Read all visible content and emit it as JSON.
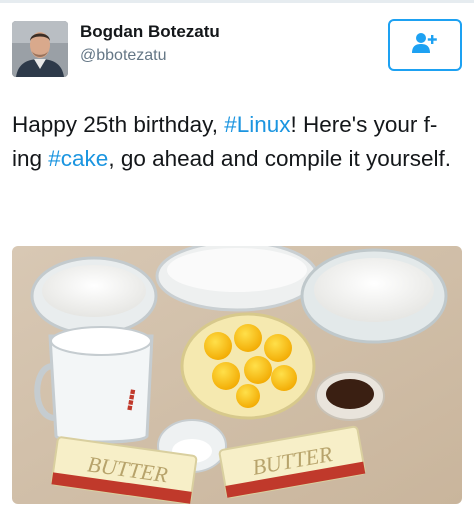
{
  "user": {
    "display_name": "Bogdan Botezatu",
    "handle": "@bbotezatu"
  },
  "follow_button": {
    "icon": "add-user-icon"
  },
  "tweet": {
    "text_1": "Happy 25th birthday, ",
    "hashtag_1": "#Linux",
    "text_2": "! Here's your f-ing ",
    "hashtag_2": "#cake",
    "text_3": ", go ahead and compile it yourself."
  },
  "photo": {
    "butter_label_left": "BUTTER",
    "butter_label_right": "BUTTER"
  },
  "colors": {
    "accent": "#1da1f2",
    "hashtag": "#1b95e0",
    "handle": "#657786"
  }
}
